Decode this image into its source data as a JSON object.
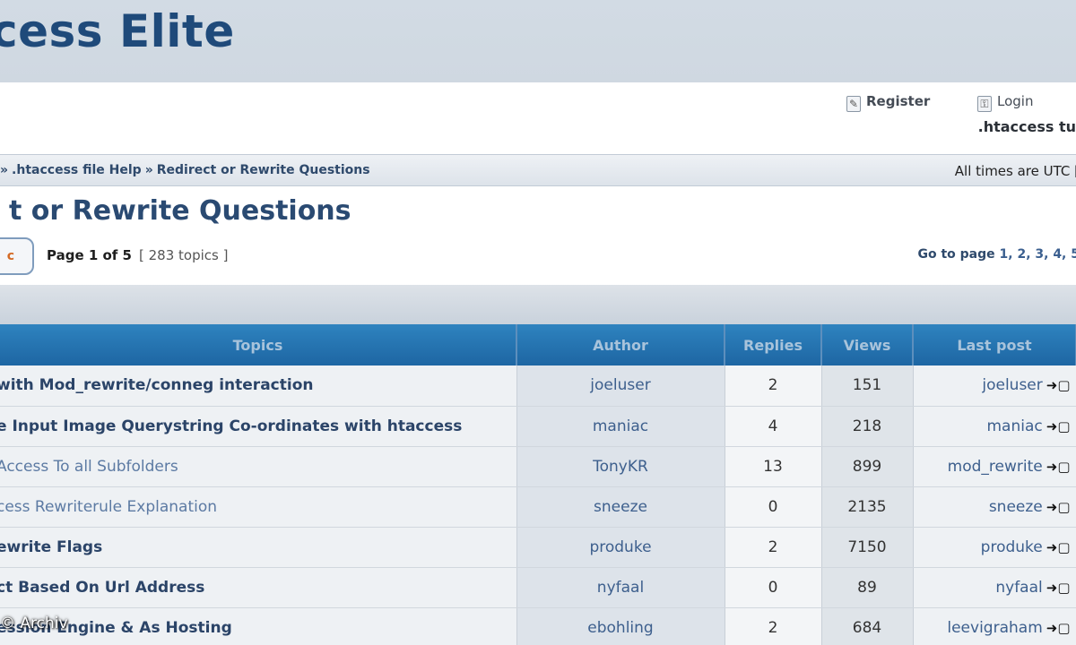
{
  "banner": {
    "title": "cess Elite"
  },
  "userbar": {
    "register_label": "Register",
    "register_icon": "register-icon",
    "login_label": "Login",
    "login_icon": "login-icon",
    "subtitle": ".htaccess tu"
  },
  "breadcrumb": {
    "prefix": "»",
    "items": [
      ".htaccess file Help",
      "Redirect or Rewrite Questions"
    ],
    "separator": "»"
  },
  "times_text": "All times are UTC [",
  "forum_title": "t or Rewrite Questions",
  "new_topic_label": "c",
  "pagination": {
    "page_info": "Page 1 of 5",
    "topic_count": "[ 283 topics ]",
    "goto_label": "Go to page",
    "pages": "1, 2, 3, 4, 5"
  },
  "table": {
    "headers": {
      "topics": "Topics",
      "author": "Author",
      "replies": "Replies",
      "views": "Views",
      "last_post": "Last post"
    },
    "rows": [
      {
        "title": "with Mod_rewrite/conneg interaction",
        "author": "joeluser",
        "replies": "2",
        "views": "151",
        "last": "joeluser",
        "visited": false
      },
      {
        "title": "e Input Image Querystring Co-ordinates with htaccess",
        "author": "maniac",
        "replies": "4",
        "views": "218",
        "last": "maniac",
        "visited": false
      },
      {
        "title": "Access To all Subfolders",
        "author": "TonyKR",
        "replies": "13",
        "views": "899",
        "last": "mod_rewrite",
        "visited": true
      },
      {
        "title": "cess Rewriterule Explanation",
        "author": "sneeze",
        "replies": "0",
        "views": "2135",
        "last": "sneeze",
        "visited": true
      },
      {
        "title": "ewrite Flags",
        "author": "produke",
        "replies": "2",
        "views": "7150",
        "last": "produke",
        "visited": false
      },
      {
        "title": "ct Based On Url Address",
        "author": "nyfaal",
        "replies": "0",
        "views": "89",
        "last": "nyfaal",
        "visited": false
      },
      {
        "title": "ession Engine & As Hosting",
        "author": "ebohling",
        "replies": "2",
        "views": "684",
        "last": "leevigraham",
        "visited": false
      }
    ],
    "last_post_icon": "view-latest-post-icon"
  },
  "watermark": "© Archiv"
}
